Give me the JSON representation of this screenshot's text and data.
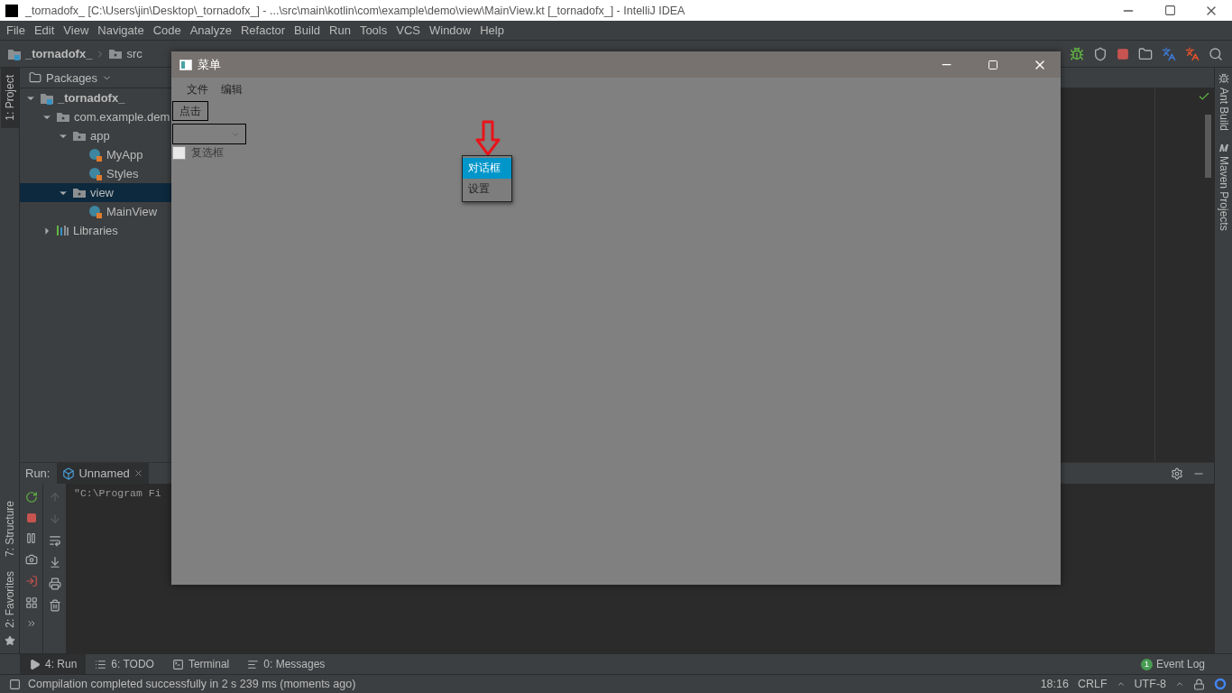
{
  "ide_window": {
    "title": "_tornadofx_ [C:\\Users\\jin\\Desktop\\_tornadofx_] - ...\\src\\main\\kotlin\\com\\example\\demo\\view\\MainView.kt [_tornadofx_] - IntelliJ IDEA"
  },
  "menu": [
    "File",
    "Edit",
    "View",
    "Navigate",
    "Code",
    "Analyze",
    "Refactor",
    "Build",
    "Run",
    "Tools",
    "VCS",
    "Window",
    "Help"
  ],
  "breadcrumbs": [
    "_tornadofx_",
    "src"
  ],
  "left_stripe_top": [
    {
      "label": "1: Project",
      "selected": true
    }
  ],
  "left_stripe_bottom": [
    {
      "label": "7: Structure",
      "selected": false
    },
    {
      "label": "2: Favorites",
      "selected": false
    }
  ],
  "right_stripe": [
    {
      "label": "Ant Build",
      "kind": "ant"
    },
    {
      "label": "Maven Projects",
      "kind": "maven"
    }
  ],
  "project_panel": {
    "view": "Packages",
    "tree": [
      {
        "label": "_tornadofx_",
        "kind": "module",
        "expanded": true,
        "selected": false,
        "children": [
          {
            "label": "com.example.dem",
            "kind": "package",
            "expanded": true,
            "selected": false,
            "children": [
              {
                "label": "app",
                "kind": "package",
                "expanded": true,
                "selected": false,
                "children": [
                  {
                    "label": "MyApp",
                    "kind": "class",
                    "selected": false
                  },
                  {
                    "label": "Styles",
                    "kind": "class",
                    "selected": false
                  }
                ]
              },
              {
                "label": "view",
                "kind": "package",
                "expanded": true,
                "selected": true,
                "children": [
                  {
                    "label": "MainView",
                    "kind": "class",
                    "selected": false
                  }
                ]
              }
            ]
          },
          {
            "label": "Libraries",
            "kind": "libraries",
            "expanded": false,
            "selected": false
          }
        ]
      }
    ]
  },
  "run_panel": {
    "label": "Run:",
    "tabs": [
      {
        "label": "Unnamed",
        "selected": true
      }
    ],
    "console": [
      "\"C:\\Program Fi"
    ]
  },
  "tool_buttons": [
    {
      "label": "4: Run",
      "kind": "run",
      "selected": true
    },
    {
      "label": "6: TODO",
      "kind": "todo",
      "selected": false
    },
    {
      "label": "Terminal",
      "kind": "terminal",
      "selected": false
    },
    {
      "label": "0: Messages",
      "kind": "messages",
      "selected": false
    }
  ],
  "event_log": {
    "count": "1",
    "label": "Event Log"
  },
  "status_bar": {
    "message": "Compilation completed successfully in 2 s 239 ms (moments ago)",
    "position": "18:16",
    "line_separator": "CRLF",
    "encoding": "UTF-8"
  },
  "app_window": {
    "title": "菜单",
    "menu": [
      "文件",
      "编辑"
    ],
    "button": "点击",
    "checkbox": {
      "label": "复选框",
      "checked": false
    },
    "popup": [
      {
        "label": "对话框",
        "selected": true
      },
      {
        "label": "设置",
        "selected": false
      }
    ]
  }
}
